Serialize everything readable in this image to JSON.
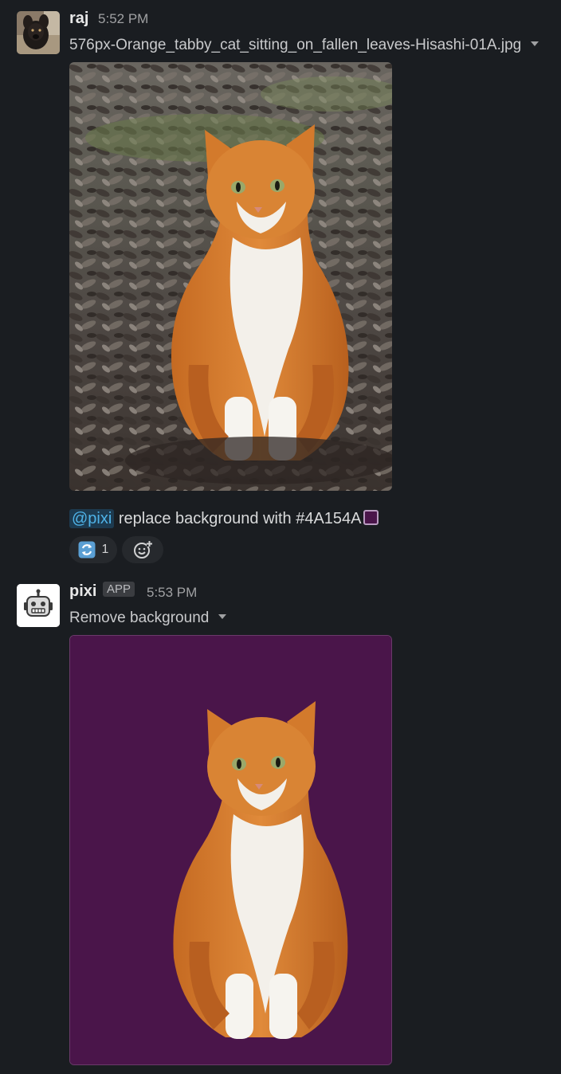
{
  "messages": [
    {
      "user": "raj",
      "time": "5:52 PM",
      "file_title": "576px-Orange_tabby_cat_sitting_on_fallen_leaves-Hisashi-01A.jpg",
      "text_mention": "@pixi",
      "text_body": " replace background with #4A154A",
      "reaction_count": "1"
    },
    {
      "user": "pixi",
      "badge": "APP",
      "time": "5:53 PM",
      "file_title": "Remove background",
      "bg_color": "#4A154A"
    }
  ]
}
